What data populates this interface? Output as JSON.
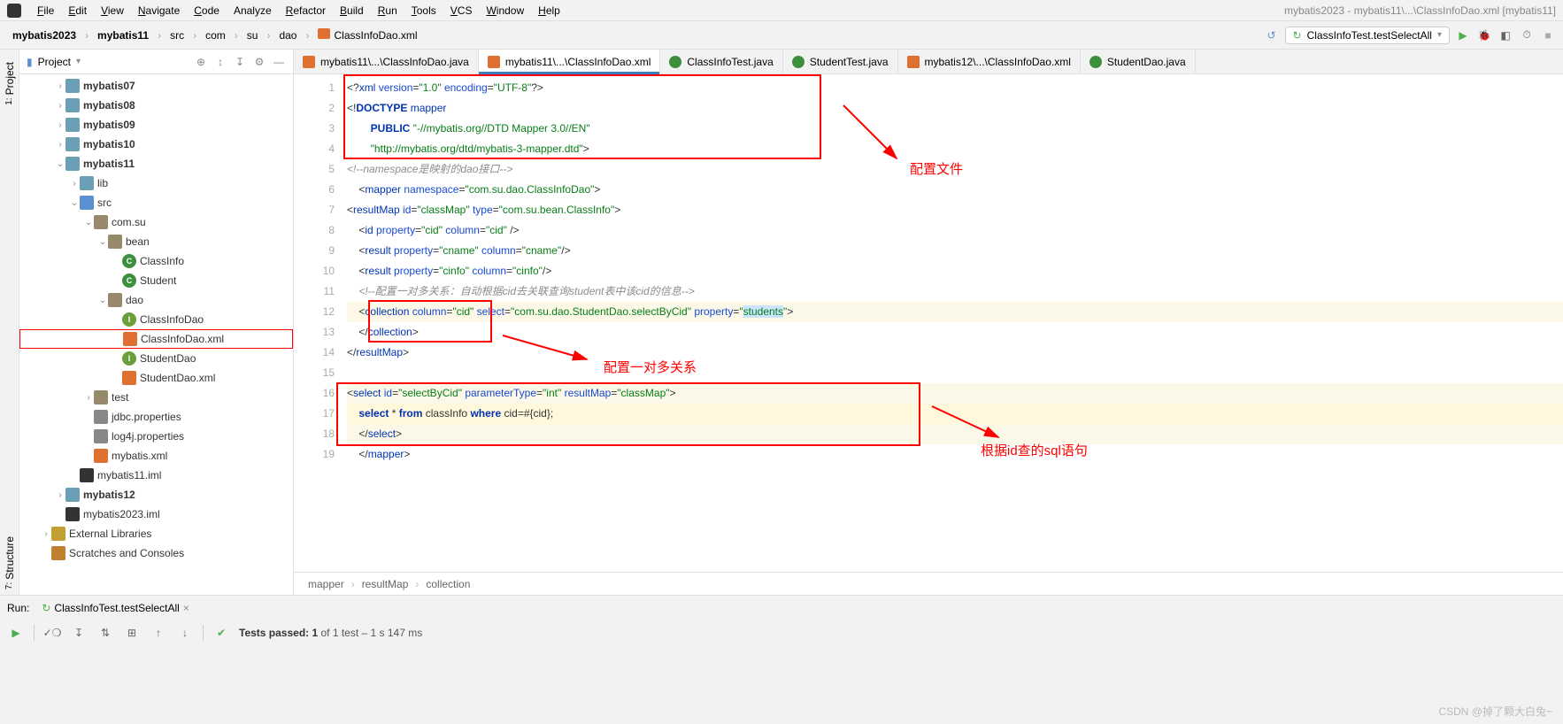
{
  "window_title": "mybatis2023 - mybatis11\\...\\ClassInfoDao.xml [mybatis11]",
  "menu": [
    "File",
    "Edit",
    "View",
    "Navigate",
    "Code",
    "Analyze",
    "Refactor",
    "Build",
    "Run",
    "Tools",
    "VCS",
    "Window",
    "Help"
  ],
  "menu_underline": [
    "F",
    "E",
    "V",
    "N",
    "C",
    null,
    "R",
    "B",
    "R",
    "T",
    "V",
    "W",
    "H"
  ],
  "breadcrumb": {
    "items": [
      {
        "label": "mybatis2023",
        "bold": true
      },
      {
        "label": "mybatis11",
        "bold": true
      },
      {
        "label": "src",
        "bold": false
      },
      {
        "label": "com",
        "bold": false
      },
      {
        "label": "su",
        "bold": false
      },
      {
        "label": "dao",
        "bold": false
      },
      {
        "label": "ClassInfoDao.xml",
        "bold": false,
        "icon": "xml"
      }
    ]
  },
  "run_config": "ClassInfoTest.testSelectAll",
  "left_vertical_tabs": [
    {
      "num": "1:",
      "label": "Project"
    },
    {
      "num": "7:",
      "label": "Structure"
    }
  ],
  "sidebar": {
    "title": "Project"
  },
  "tree": [
    {
      "indent": 2,
      "chev": "›",
      "icon": "folder",
      "label": "mybatis07",
      "bold": true
    },
    {
      "indent": 2,
      "chev": "›",
      "icon": "folder",
      "label": "mybatis08",
      "bold": true
    },
    {
      "indent": 2,
      "chev": "›",
      "icon": "folder",
      "label": "mybatis09",
      "bold": true
    },
    {
      "indent": 2,
      "chev": "›",
      "icon": "folder",
      "label": "mybatis10",
      "bold": true
    },
    {
      "indent": 2,
      "chev": "⌄",
      "icon": "folder",
      "label": "mybatis11",
      "bold": true
    },
    {
      "indent": 3,
      "chev": "›",
      "icon": "folder",
      "label": "lib",
      "bold": false
    },
    {
      "indent": 3,
      "chev": "⌄",
      "icon": "folder-blue",
      "label": "src",
      "bold": false
    },
    {
      "indent": 4,
      "chev": "⌄",
      "icon": "pkg",
      "label": "com.su",
      "bold": false
    },
    {
      "indent": 5,
      "chev": "⌄",
      "icon": "pkg",
      "label": "bean",
      "bold": false
    },
    {
      "indent": 6,
      "chev": "",
      "icon": "class-c",
      "iconText": "C",
      "label": "ClassInfo",
      "bold": false
    },
    {
      "indent": 6,
      "chev": "",
      "icon": "class-c",
      "iconText": "C",
      "label": "Student",
      "bold": false
    },
    {
      "indent": 5,
      "chev": "⌄",
      "icon": "pkg",
      "label": "dao",
      "bold": false
    },
    {
      "indent": 6,
      "chev": "",
      "icon": "iface-i",
      "iconText": "I",
      "label": "ClassInfoDao",
      "bold": false
    },
    {
      "indent": 6,
      "chev": "",
      "icon": "xml",
      "iconText": "",
      "label": "ClassInfoDao.xml",
      "bold": false,
      "selected": true
    },
    {
      "indent": 6,
      "chev": "",
      "icon": "iface-i",
      "iconText": "I",
      "label": "StudentDao",
      "bold": false
    },
    {
      "indent": 6,
      "chev": "",
      "icon": "xml",
      "iconText": "",
      "label": "StudentDao.xml",
      "bold": false
    },
    {
      "indent": 4,
      "chev": "›",
      "icon": "pkg",
      "label": "test",
      "bold": false
    },
    {
      "indent": 4,
      "chev": "",
      "icon": "props",
      "iconText": "",
      "label": "jdbc.properties",
      "bold": false
    },
    {
      "indent": 4,
      "chev": "",
      "icon": "props",
      "iconText": "",
      "label": "log4j.properties",
      "bold": false
    },
    {
      "indent": 4,
      "chev": "",
      "icon": "xml",
      "iconText": "",
      "label": "mybatis.xml",
      "bold": false
    },
    {
      "indent": 3,
      "chev": "",
      "icon": "iml",
      "iconText": "",
      "label": "mybatis11.iml",
      "bold": false
    },
    {
      "indent": 2,
      "chev": "›",
      "icon": "folder",
      "label": "mybatis12",
      "bold": true
    },
    {
      "indent": 2,
      "chev": "",
      "icon": "iml",
      "iconText": "",
      "label": "mybatis2023.iml",
      "bold": false
    },
    {
      "indent": 1,
      "chev": "›",
      "icon": "lib",
      "iconText": "",
      "label": "External Libraries",
      "bold": false
    },
    {
      "indent": 1,
      "chev": "",
      "icon": "scratch",
      "iconText": "",
      "label": "Scratches and Consoles",
      "bold": false
    }
  ],
  "editor_tabs": [
    {
      "label": "mybatis11\\...\\ClassInfoDao.java",
      "icon": "xml",
      "active": false
    },
    {
      "label": "mybatis11\\...\\ClassInfoDao.xml",
      "icon": "xml",
      "active": true
    },
    {
      "label": "ClassInfoTest.java",
      "icon": "java",
      "active": false
    },
    {
      "label": "StudentTest.java",
      "icon": "java",
      "active": false
    },
    {
      "label": "mybatis12\\...\\ClassInfoDao.xml",
      "icon": "xml",
      "active": false
    },
    {
      "label": "StudentDao.java",
      "icon": "java",
      "active": false
    }
  ],
  "line_numbers": [
    "1",
    "2",
    "3",
    "4",
    "5",
    "6",
    "7",
    "8",
    "9",
    "10",
    "11",
    "12",
    "13",
    "14",
    "15",
    "16",
    "17",
    "18",
    "19"
  ],
  "code_lines": [
    {
      "html": "<span class='punct'>&lt;?</span><span class='tag'>xml</span> <span class='attr'>version</span><span class='punct'>=</span><span class='str'>\"1.0\"</span> <span class='attr'>encoding</span><span class='punct'>=</span><span class='str'>\"UTF-8\"</span><span class='punct'>?&gt;</span>"
    },
    {
      "html": "<span class='punct'>&lt;!</span><span class='kw'>DOCTYPE</span> <span class='tag'>mapper</span>"
    },
    {
      "html": "        <span class='kw'>PUBLIC</span> <span class='str'>\"-//mybatis.org//DTD Mapper 3.0//EN\"</span>"
    },
    {
      "html": "        <span class='str'>\"http://mybatis.org/dtd/mybatis-3-mapper.dtd\"</span><span class='punct'>&gt;</span>"
    },
    {
      "html": "<span class='comment'>&lt;!--namespace是映射的dao接口--&gt;</span>"
    },
    {
      "html": "    <span class='punct'>&lt;</span><span class='tag'>mapper</span> <span class='attr'>namespace</span><span class='punct'>=</span><span class='str'>\"com.su.dao.ClassInfoDao\"</span><span class='punct'>&gt;</span>"
    },
    {
      "html": "<span class='punct'>&lt;</span><span class='tag'>resultMap</span> <span class='attr'>id</span><span class='punct'>=</span><span class='str'>\"classMap\"</span> <span class='attr'>type</span><span class='punct'>=</span><span class='str'>\"com.su.bean.ClassInfo\"</span><span class='punct'>&gt;</span>"
    },
    {
      "html": "    <span class='punct'>&lt;</span><span class='tag'>id</span> <span class='attr'>property</span><span class='punct'>=</span><span class='str'>\"cid\"</span> <span class='attr'>column</span><span class='punct'>=</span><span class='str'>\"cid\"</span> <span class='punct'>/&gt;</span>"
    },
    {
      "html": "    <span class='punct'>&lt;</span><span class='tag'>result</span> <span class='attr'>property</span><span class='punct'>=</span><span class='str'>\"cname\"</span> <span class='attr'>column</span><span class='punct'>=</span><span class='str'>\"cname\"</span><span class='punct'>/&gt;</span>"
    },
    {
      "html": "    <span class='punct'>&lt;</span><span class='tag'>result</span> <span class='attr'>property</span><span class='punct'>=</span><span class='str'>\"cinfo\"</span> <span class='attr'>column</span><span class='punct'>=</span><span class='str'>\"cinfo\"</span><span class='punct'>/&gt;</span>"
    },
    {
      "html": "    <span class='comment'>&lt;!--配置一对多关系：自动根据cid去关联查询student表中该cid的信息--&gt;</span>"
    },
    {
      "html": "    <span class='punct'>&lt;</span><span class='tag'>collection</span> <span class='attr'>column</span><span class='punct'>=</span><span class='str'>\"cid\"</span> <span class='attr'>select</span><span class='punct'>=</span><span class='str'>\"com.su.dao.StudentDao.selectByCid\"</span> <span class='attr'>property</span><span class='punct'>=</span><span class='str'>\"<span class='sel-hl'>students</span>\"</span><span class='punct'>&gt;</span>",
      "hl": "hl2"
    },
    {
      "html": "    <span class='punct'>&lt;/</span><span class='tag'>collection</span><span class='punct'>&gt;</span>"
    },
    {
      "html": "<span class='punct'>&lt;/</span><span class='tag'>resultMap</span><span class='punct'>&gt;</span>"
    },
    {
      "html": ""
    },
    {
      "html": "<span class='punct'>&lt;</span><span class='tag'>select</span> <span class='attr'>id</span><span class='punct'>=</span><span class='str'>\"selectByCid\"</span> <span class='attr'>parameterType</span><span class='punct'>=</span><span class='str'>\"int\"</span> <span class='attr'>resultMap</span><span class='punct'>=</span><span class='str'>\"classMap\"</span><span class='punct'>&gt;</span>",
      "hl": "hl2"
    },
    {
      "html": "    <span class='kw'>select</span> <span class='text'>*</span> <span class='kw'>from</span> <span class='text'>classInfo</span> <span class='kw'>where</span> <span class='text'>cid=#{cid};</span>",
      "hl": "hl"
    },
    {
      "html": "    <span class='punct'>&lt;/</span><span class='tag'>select</span><span class='punct'>&gt;</span>",
      "hl": "hl2"
    },
    {
      "html": "    <span class='punct'>&lt;/</span><span class='tag'>mapper</span><span class='punct'>&gt;</span>"
    }
  ],
  "annotations": {
    "config_file": "配置文件",
    "one_to_many": "配置一对多关系",
    "sql_by_id": "根据id查的sql语句"
  },
  "editor_breadcrumb": [
    "mapper",
    "resultMap",
    "collection"
  ],
  "run": {
    "label": "Run:",
    "tab": "ClassInfoTest.testSelectAll",
    "status_prefix": "Tests passed: 1",
    "status_suffix": " of 1 test – 1 s 147 ms"
  },
  "watermark": "CSDN @掉了颗大白兔~"
}
